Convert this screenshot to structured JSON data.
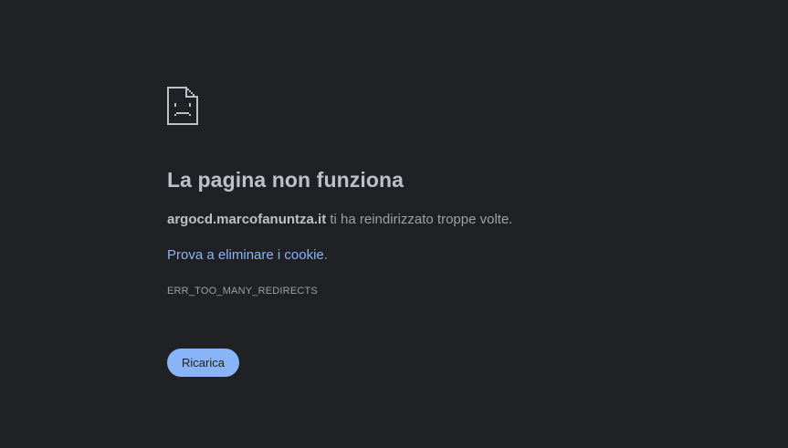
{
  "colors": {
    "background": "#202124",
    "title": "#bdc1c6",
    "text": "#9aa0a6",
    "link": "#8ab4f8",
    "button_bg": "#8ab4f8",
    "button_text": "#202124"
  },
  "icon": {
    "name": "sad-document-icon"
  },
  "error": {
    "title": "La pagina non funziona",
    "host": "argocd.marcofanuntza.it",
    "message": " ti ha reindirizzato troppe volte.",
    "suggestion_link": "Prova a eliminare i cookie",
    "suggestion_suffix": ".",
    "code": "ERR_TOO_MANY_REDIRECTS"
  },
  "actions": {
    "reload_label": "Ricarica"
  }
}
